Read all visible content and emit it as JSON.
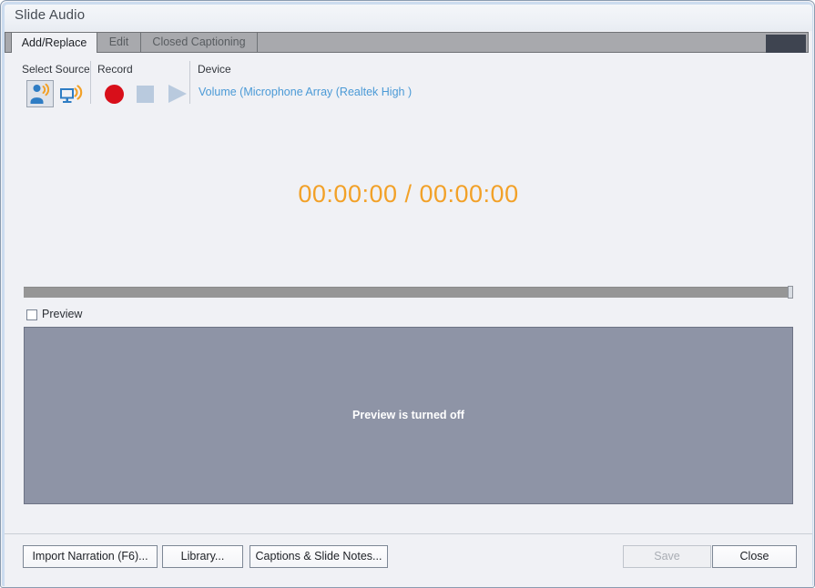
{
  "window": {
    "title": "Slide Audio"
  },
  "tabs": [
    {
      "label": "Add/Replace",
      "active": true
    },
    {
      "label": "Edit",
      "active": false
    },
    {
      "label": "Closed Captioning",
      "active": false
    }
  ],
  "toolbar": {
    "groups": {
      "select_source_label": "Select Source",
      "record_label": "Record",
      "device_label": "Device"
    },
    "sources": [
      {
        "name": "microphone-source",
        "selected": true
      },
      {
        "name": "system-audio-source",
        "selected": false
      }
    ],
    "transport": {
      "record_label": "Record",
      "stop_label": "Stop",
      "play_label": "Play"
    },
    "device_value": "Volume (Microphone Array  (Realtek High )"
  },
  "player": {
    "timer": "00:00:00 / 00:00:00",
    "timer_color": "#f2a128",
    "seek_position_percent": 100
  },
  "preview": {
    "checkbox_label": "Preview",
    "checked": false,
    "panel_message": "Preview is turned off"
  },
  "footer": {
    "import_label": "Import Narration (F6)...",
    "library_label": "Library...",
    "captions_label": "Captions & Slide Notes...",
    "save_label": "Save",
    "close_label": "Close"
  }
}
